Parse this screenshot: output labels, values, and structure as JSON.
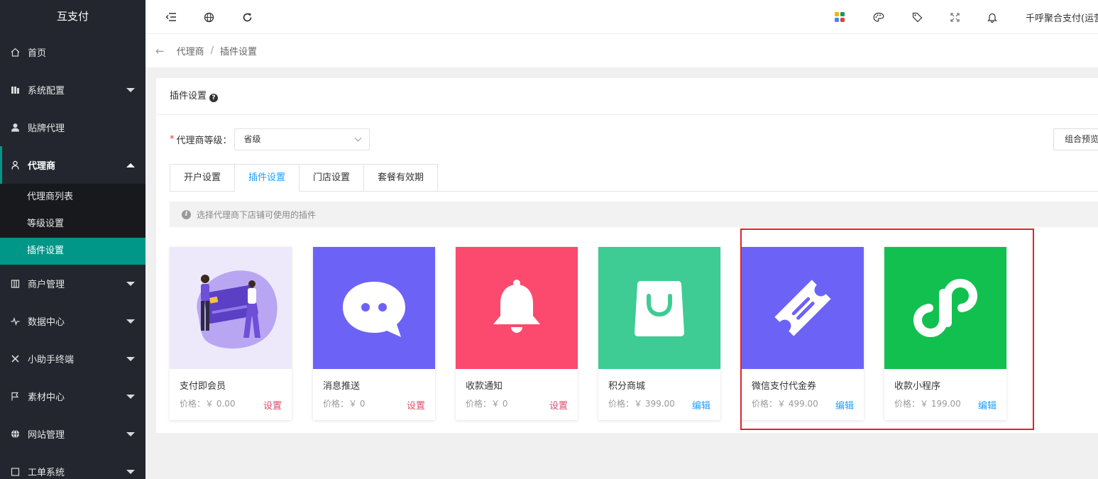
{
  "sidebar": {
    "brand": "互支付",
    "items": [
      {
        "label": "首页",
        "icon": "home-icon"
      },
      {
        "label": "系统配置",
        "icon": "config-icon"
      },
      {
        "label": "贴牌代理",
        "icon": "user-icon"
      },
      {
        "label": "代理商",
        "icon": "agent-icon"
      },
      {
        "label": "商户管理",
        "icon": "store-icon"
      },
      {
        "label": "数据中心",
        "icon": "pulse-icon"
      },
      {
        "label": "小助手终端",
        "icon": "tools-icon"
      },
      {
        "label": "素材中心",
        "icon": "flag-icon"
      },
      {
        "label": "网站管理",
        "icon": "globe-icon"
      },
      {
        "label": "工单系统",
        "icon": "ticket-icon"
      }
    ],
    "submenu": [
      "代理商列表",
      "等级设置",
      "插件设置"
    ]
  },
  "topbar": {
    "user_name": "千呼聚合支付(运营"
  },
  "breadcrumb": {
    "parent": "代理商",
    "separator": "/",
    "current": "插件设置"
  },
  "panel": {
    "title": "插件设置",
    "help": "?",
    "level_label": "代理商等级：",
    "level_required": "*",
    "level_value": "省级",
    "preview_button": "组合预览",
    "tabs": [
      "开户设置",
      "插件设置",
      "门店设置",
      "套餐有效期"
    ],
    "tip": "选择代理商下店铺可使用的插件",
    "tip_icon": "i"
  },
  "plugins": [
    {
      "name": "支付即会员",
      "price": "价格：￥ 0.00",
      "action": "设置",
      "color": "#ede9fb"
    },
    {
      "name": "消息推送",
      "price": "价格：￥ 0",
      "action": "设置",
      "color": "#6c63f6"
    },
    {
      "name": "收款通知",
      "price": "价格：￥ 0",
      "action": "设置",
      "color": "#fb4a6e"
    },
    {
      "name": "积分商城",
      "price": "价格：￥ 399.00",
      "action": "编辑",
      "color": "#3ecb94"
    },
    {
      "name": "微信支付代金券",
      "price": "价格：￥ 499.00",
      "action": "编辑",
      "color": "#6c63f6"
    },
    {
      "name": "收款小程序",
      "price": "价格：￥ 199.00",
      "action": "编辑",
      "color": "#12c04f"
    }
  ],
  "colors": {
    "sidebar_bg": "#23262e",
    "accent": "#009688",
    "link_blue": "#1e9fff",
    "link_red": "#e14c6c",
    "highlight_border": "#e2232a"
  }
}
